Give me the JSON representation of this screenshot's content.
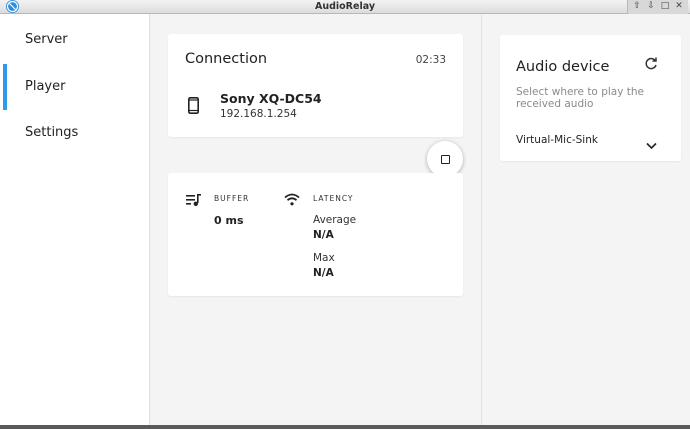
{
  "window": {
    "title": "AudioRelay"
  },
  "colors": {
    "accent": "#2f9be8",
    "sidebar_bg": "#ffffff",
    "content_bg": "#f4f4f4"
  },
  "sidebar": {
    "items": [
      {
        "label": "Server",
        "active": false
      },
      {
        "label": "Player",
        "active": true
      },
      {
        "label": "Settings",
        "active": false
      }
    ]
  },
  "connection": {
    "title": "Connection",
    "elapsed": "02:33",
    "device_icon": "smartphone-icon",
    "device_name": "Sony XQ-DC54",
    "device_ip": "192.168.1.254",
    "stop_icon": "stop-icon"
  },
  "stats": {
    "buffer": {
      "icon": "queue-music-icon",
      "label": "BUFFER",
      "value": "0 ms"
    },
    "latency": {
      "icon": "wifi-icon",
      "label": "LATENCY",
      "average_label": "Average",
      "average_value": "N/A",
      "max_label": "Max",
      "max_value": "N/A"
    }
  },
  "audio_device": {
    "title": "Audio device",
    "subtitle": "Select where to play the received audio",
    "selected": "Virtual-Mic-Sink",
    "refresh_icon": "refresh-icon",
    "dropdown_icon": "chevron-down-icon"
  }
}
